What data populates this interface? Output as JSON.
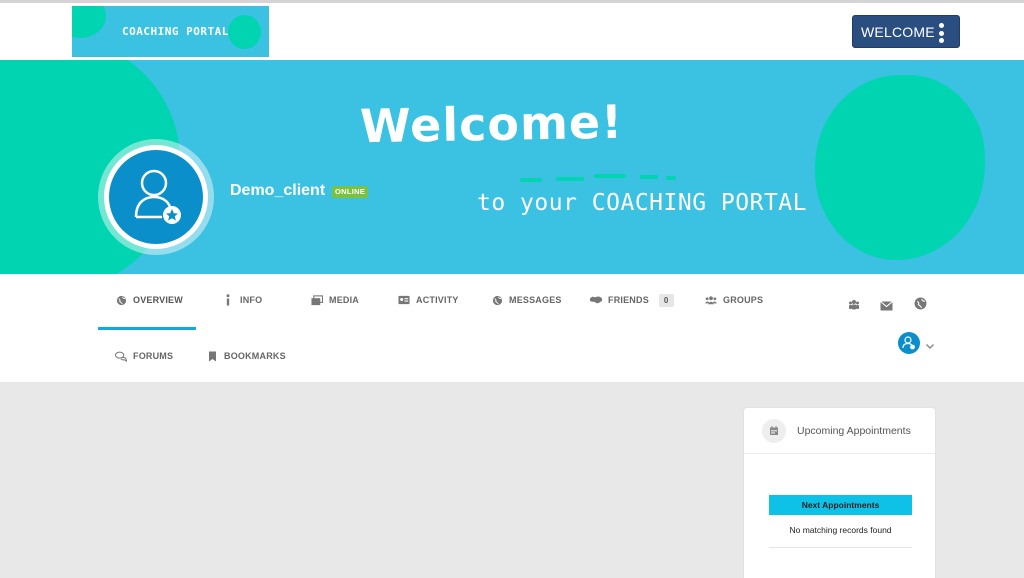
{
  "header": {
    "logo_text": "COACHING PORTAL",
    "welcome_label": "WELCOME"
  },
  "banner": {
    "headline": "Welcome!",
    "subline": "to your COACHING PORTAL"
  },
  "profile": {
    "username": "Demo_client",
    "status": "ONLINE"
  },
  "nav": {
    "tabs": [
      {
        "label": "OVERVIEW",
        "icon": "globe-icon",
        "active": true
      },
      {
        "label": "INFO",
        "icon": "info-icon"
      },
      {
        "label": "MEDIA",
        "icon": "media-icon"
      },
      {
        "label": "ACTIVITY",
        "icon": "id-card-icon"
      },
      {
        "label": "MESSAGES",
        "icon": "globe-icon"
      },
      {
        "label": "FRIENDS",
        "icon": "handshake-icon",
        "count": "0"
      },
      {
        "label": "GROUPS",
        "icon": "users-icon"
      },
      {
        "label": "FORUMS",
        "icon": "chat-icon"
      },
      {
        "label": "BOOKMARKS",
        "icon": "bookmark-icon"
      }
    ],
    "utility_icons": [
      "users-icon",
      "mail-icon",
      "globe-icon"
    ]
  },
  "widget": {
    "title": "Upcoming Appointments",
    "table_header": "Next Appointments",
    "empty_text": "No matching records found"
  },
  "colors": {
    "banner": "#3bc1e1",
    "blob": "#00d4b0",
    "welcome_button": "#2b4e80",
    "online_badge": "#7bc142",
    "active_tab": "#14a9db",
    "appointments_header": "#0ec1e6"
  }
}
